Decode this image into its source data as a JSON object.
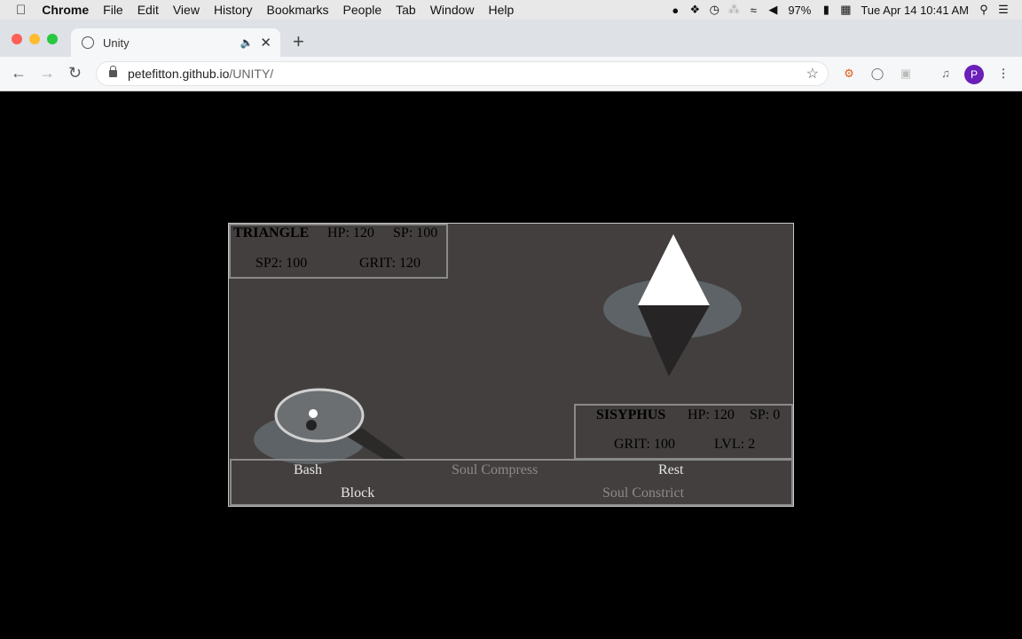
{
  "menubar": {
    "app": "Chrome",
    "items": [
      "File",
      "Edit",
      "View",
      "History",
      "Bookmarks",
      "People",
      "Tab",
      "Window",
      "Help"
    ],
    "battery": "97%",
    "clock": "Tue Apr 14  10:41 AM"
  },
  "browser": {
    "tab_title": "Unity",
    "url_host": "petefitton.github.io",
    "url_path": "/UNITY/",
    "profile_initial": "P"
  },
  "game": {
    "enemy": {
      "name": "TRIANGLE",
      "hp": "HP: 120",
      "sp": "SP: 100",
      "sp2": "SP2: 100",
      "grit": "GRIT: 120"
    },
    "player": {
      "name": "SISYPHUS",
      "hp": "HP: 120",
      "sp": "SP: 0",
      "grit": "GRIT: 100",
      "lvl": "LVL: 2"
    },
    "actions": {
      "bash": "Bash",
      "soul_compress": "Soul Compress",
      "rest": "Rest",
      "block": "Block",
      "soul_constrict": "Soul Constrict"
    }
  }
}
